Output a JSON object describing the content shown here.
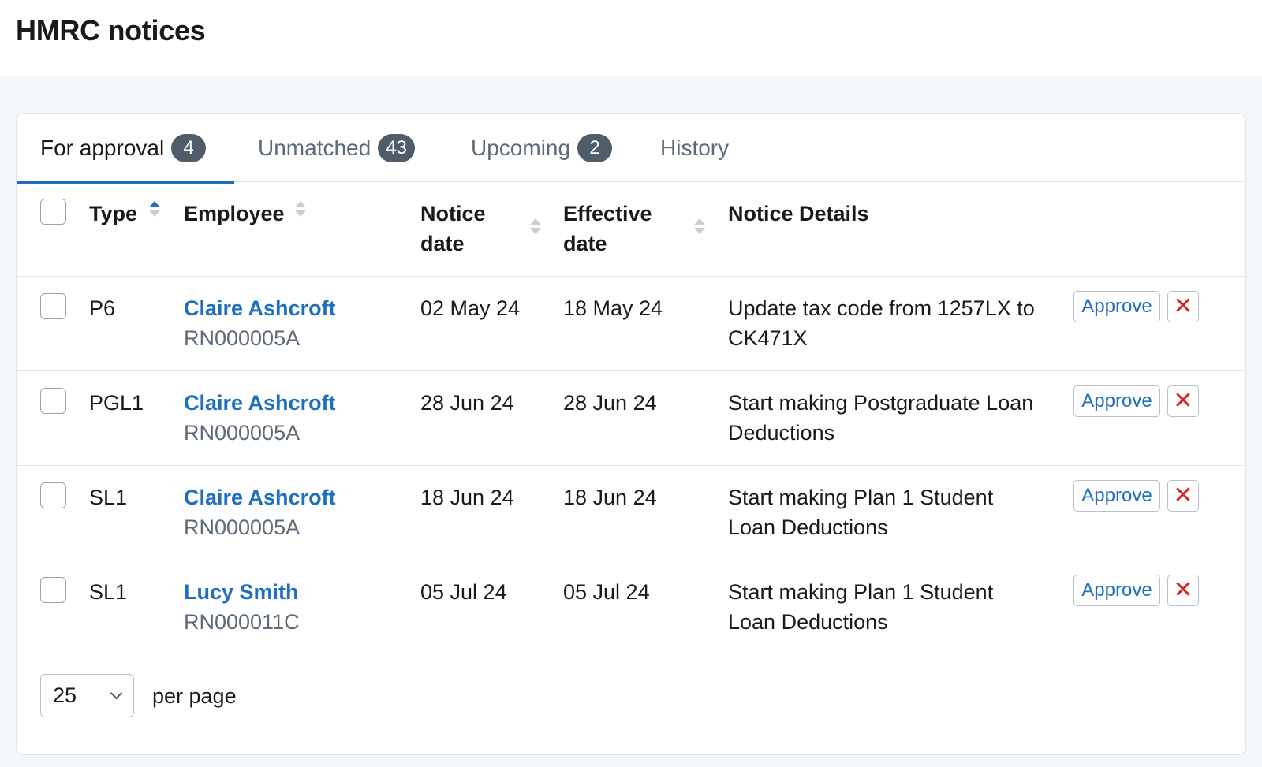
{
  "header": {
    "title": "HMRC notices"
  },
  "tabs": [
    {
      "label": "For approval",
      "count": "4",
      "active": true
    },
    {
      "label": "Unmatched",
      "count": "43"
    },
    {
      "label": "Upcoming",
      "count": "2"
    },
    {
      "label": "History",
      "count": ""
    }
  ],
  "table": {
    "columns": {
      "type": "Type",
      "employee": "Employee",
      "notice_date": "Notice date",
      "effective_date": "Effective date",
      "notice_details": "Notice Details"
    },
    "rows": [
      {
        "type": "P6",
        "employee_name": "Claire Ashcroft",
        "employee_ref": "RN000005A",
        "notice_date": "02 May 24",
        "effective_date": "18 May 24",
        "details": "Update tax code from 1257LX to CK471X"
      },
      {
        "type": "PGL1",
        "employee_name": "Claire Ashcroft",
        "employee_ref": "RN000005A",
        "notice_date": "28 Jun 24",
        "effective_date": "28 Jun 24",
        "details": "Start making Postgraduate Loan Deductions"
      },
      {
        "type": "SL1",
        "employee_name": "Claire Ashcroft",
        "employee_ref": "RN000005A",
        "notice_date": "18 Jun 24",
        "effective_date": "18 Jun 24",
        "details": "Start making Plan 1 Student Loan Deductions"
      },
      {
        "type": "SL1",
        "employee_name": "Lucy Smith",
        "employee_ref": "RN000011C",
        "notice_date": "05 Jul 24",
        "effective_date": "05 Jul 24",
        "details": "Start making Plan 1 Student Loan Deductions"
      }
    ],
    "actions": {
      "approve_label": "Approve",
      "reject_symbol": "✕"
    }
  },
  "pagination": {
    "per_page_value": "25",
    "per_page_label": "per page"
  },
  "colors": {
    "accent": "#1f6fbf",
    "reject": "#e02020",
    "badge": "#4f5d6b"
  }
}
